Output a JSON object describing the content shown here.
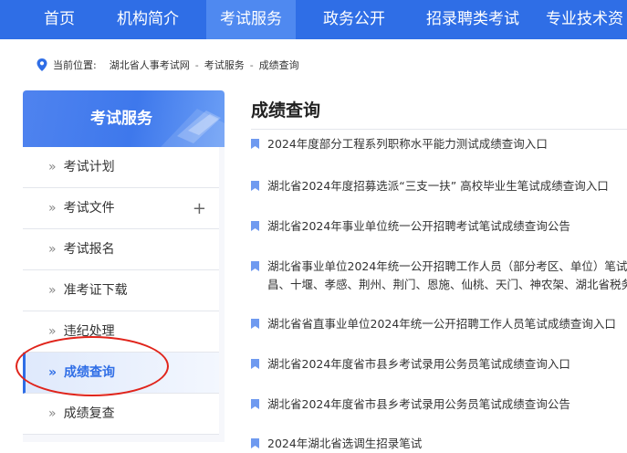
{
  "nav": {
    "items": [
      {
        "label": "首页",
        "active": false
      },
      {
        "label": "机构简介",
        "active": false
      },
      {
        "label": "考试服务",
        "active": true
      },
      {
        "label": "政务公开",
        "active": false
      },
      {
        "label": "招录聘类考试",
        "active": false
      },
      {
        "label": "专业技术资",
        "active": false
      }
    ]
  },
  "breadcrumb": {
    "prefix": "当前位置:",
    "items": [
      "湖北省人事考试网",
      "考试服务",
      "成绩查询"
    ],
    "separator": "-"
  },
  "sidebar": {
    "title": "考试服务",
    "items": [
      {
        "label": "考试计划",
        "active": false,
        "expandable": false
      },
      {
        "label": "考试文件",
        "active": false,
        "expandable": true
      },
      {
        "label": "考试报名",
        "active": false,
        "expandable": false
      },
      {
        "label": "准考证下载",
        "active": false,
        "expandable": false
      },
      {
        "label": "违纪处理",
        "active": false,
        "expandable": false
      },
      {
        "label": "成绩查询",
        "active": true,
        "expandable": false
      },
      {
        "label": "成绩复查",
        "active": false,
        "expandable": false
      }
    ],
    "chevron": "»",
    "plus": "+"
  },
  "main": {
    "title": "成绩查询",
    "articles": [
      {
        "lines": [
          "2024年度部分工程系列职称水平能力测试成绩查询入口"
        ]
      },
      {
        "lines": [
          "湖北省2024年度招募选派“三支一扶” 高校毕业生笔试成绩查询入口"
        ]
      },
      {
        "lines": [
          "湖北省2024年事业单位统一公开招聘考试笔试成绩查询公告"
        ]
      },
      {
        "lines": [
          "湖北省事业单位2024年统一公开招聘工作人员（部分考区、单位）笔试成",
          "昌、十堰、孝感、荆州、荆门、恩施、仙桃、天门、神农架、湖北省税务"
        ]
      },
      {
        "lines": [
          "湖北省省直事业单位2024年统一公开招聘工作人员笔试成绩查询入口"
        ]
      },
      {
        "lines": [
          "湖北省2024年度省市县乡考试录用公务员笔试成绩查询入口"
        ]
      },
      {
        "lines": [
          "湖北省2024年度省市县乡考试录用公务员笔试成绩查询公告"
        ]
      },
      {
        "lines": [
          "2024年湖北省选调生招录笔试"
        ]
      }
    ]
  },
  "colors": {
    "nav_bg": "#2f6ee6",
    "nav_active": "#4f89f0",
    "accent": "#2f6ee6",
    "annotation": "#e0241b"
  }
}
